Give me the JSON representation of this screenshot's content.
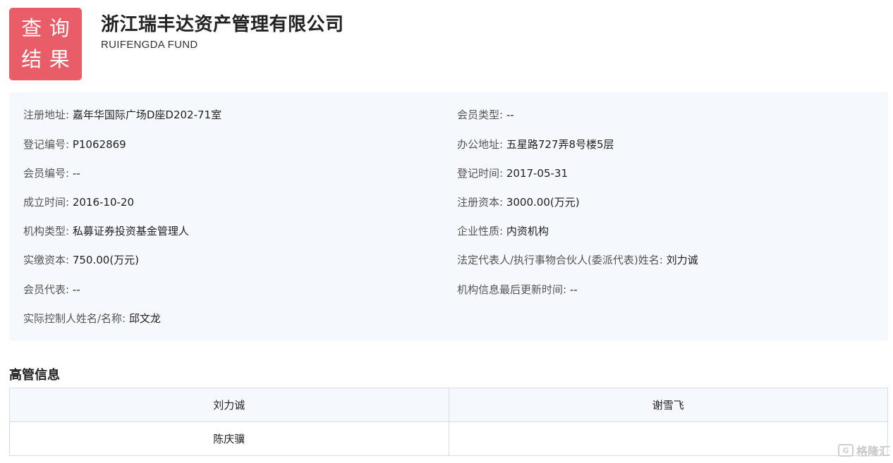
{
  "badge": {
    "chars": [
      "查",
      "询",
      "结",
      "果"
    ]
  },
  "company": {
    "name": "浙江瑞丰达资产管理有限公司",
    "english_name": "RUIFENGDA FUND"
  },
  "info": {
    "left": [
      {
        "label": "注册地址:",
        "value": "嘉年华国际广场D座D202-71室"
      },
      {
        "label": "登记编号:",
        "value": "P1062869"
      },
      {
        "label": "会员编号:",
        "value": "--"
      },
      {
        "label": "成立时间:",
        "value": "2016-10-20"
      },
      {
        "label": "机构类型:",
        "value": "私募证券投资基金管理人"
      },
      {
        "label": "实缴资本:",
        "value": "750.00(万元)"
      },
      {
        "label": "会员代表:",
        "value": "--"
      },
      {
        "label": "实际控制人姓名/名称:",
        "value": "邱文龙"
      }
    ],
    "right": [
      {
        "label": "会员类型:",
        "value": "--"
      },
      {
        "label": "办公地址:",
        "value": "五星路727弄8号楼5层"
      },
      {
        "label": "登记时间:",
        "value": "2017-05-31"
      },
      {
        "label": "注册资本:",
        "value": "3000.00(万元)"
      },
      {
        "label": "企业性质:",
        "value": "内资机构"
      },
      {
        "label": "法定代表人/执行事物合伙人(委派代表)姓名:",
        "value": "刘力诚"
      },
      {
        "label": "机构信息最后更新时间:",
        "value": "--"
      }
    ]
  },
  "executives": {
    "title": "高管信息",
    "rows": [
      [
        "刘力诚",
        "谢雪飞"
      ],
      [
        "陈庆骥",
        ""
      ]
    ]
  },
  "watermark": {
    "icon": "G",
    "text": "格隆汇"
  }
}
